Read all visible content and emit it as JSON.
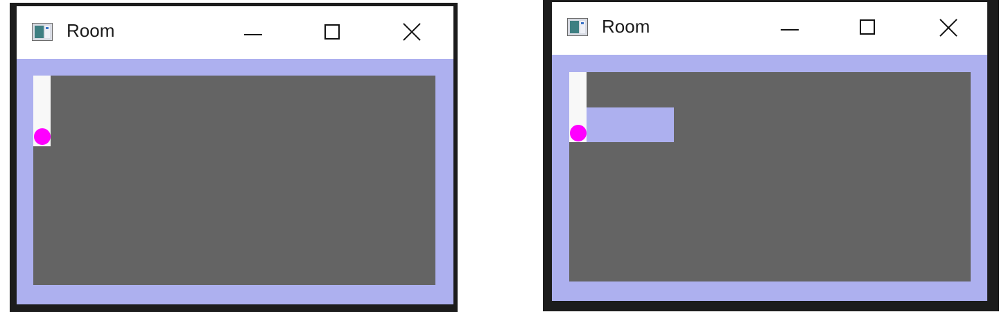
{
  "colors": {
    "frame": "#1c1c1c",
    "border_fill": "#adb0ef",
    "room_fill": "#646464",
    "start_strip": "#f8f8f8",
    "agent_dot": "#ff00ff"
  },
  "windows": [
    {
      "title": "Room",
      "icon": "app-window-icon",
      "controls": [
        "minimize-icon",
        "maximize-icon",
        "close-icon"
      ]
    },
    {
      "title": "Room",
      "icon": "app-window-icon",
      "controls": [
        "minimize-icon",
        "maximize-icon",
        "close-icon"
      ]
    }
  ]
}
